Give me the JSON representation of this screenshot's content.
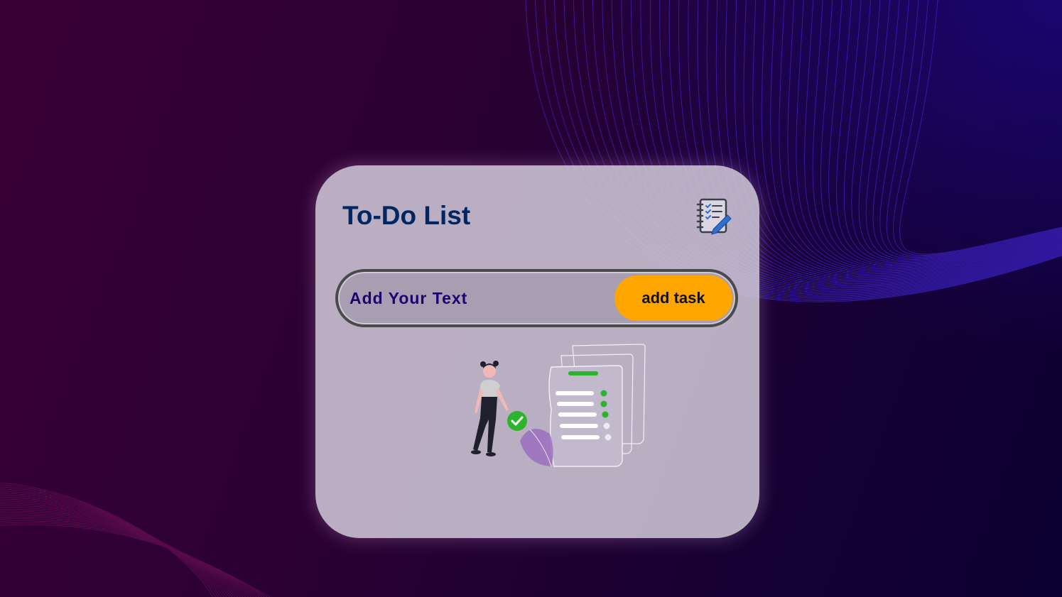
{
  "app": {
    "title": "To-Do List",
    "icon": "notebook-checklist-icon"
  },
  "task_form": {
    "input_value": "",
    "input_placeholder": "Add Your Text",
    "add_button_label": "add task"
  },
  "illustration": {
    "name": "woman-with-checklist-illustration"
  },
  "colors": {
    "title": "#002765",
    "button": "#ffa500",
    "placeholder": "#1f0073",
    "check": "#2cb52c",
    "background_left": "#3a0036",
    "background_right": "#0c0033",
    "wave_lines": "#3b1fe0"
  }
}
